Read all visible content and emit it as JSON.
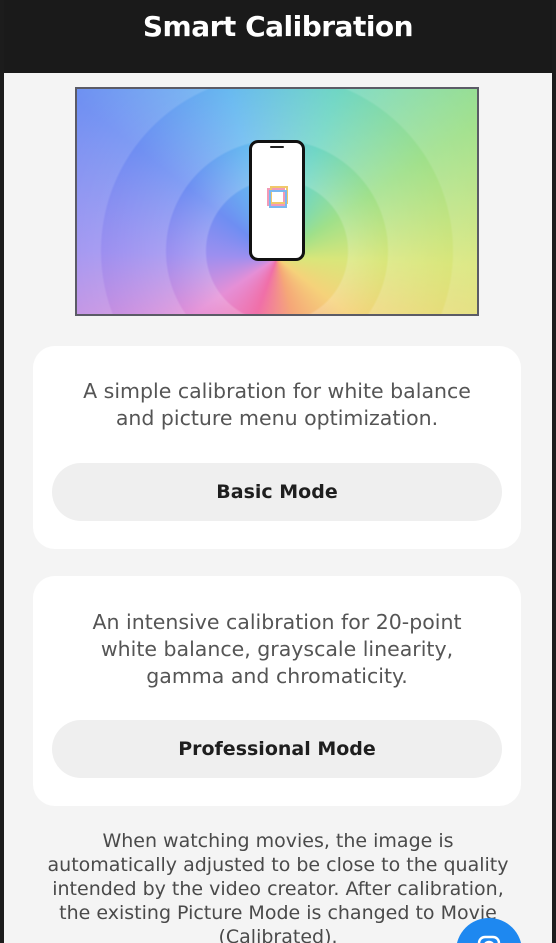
{
  "header": {
    "title": "Smart Calibration"
  },
  "hero": {
    "image": "phone-calibration-illustration"
  },
  "basic_card": {
    "description": "A simple calibration for white balance and picture menu optimization.",
    "button_label": "Basic Mode"
  },
  "pro_card": {
    "description": "An intensive calibration for 20-point white balance, grayscale linearity, gamma and chromaticity.",
    "button_label": "Professional Mode"
  },
  "footer": {
    "note": "When watching movies, the image is automatically adjusted to be close to the quality intended by the video creator. After calibration, the existing Picture Mode is changed to Movie (Calibrated)."
  },
  "fab": {
    "icon": "camera-icon",
    "color": "#1e88f0"
  },
  "colors": {
    "header_bg": "#1a1a1a",
    "page_bg": "#f4f4f4",
    "card_bg": "#ffffff",
    "button_bg": "#efefef"
  }
}
